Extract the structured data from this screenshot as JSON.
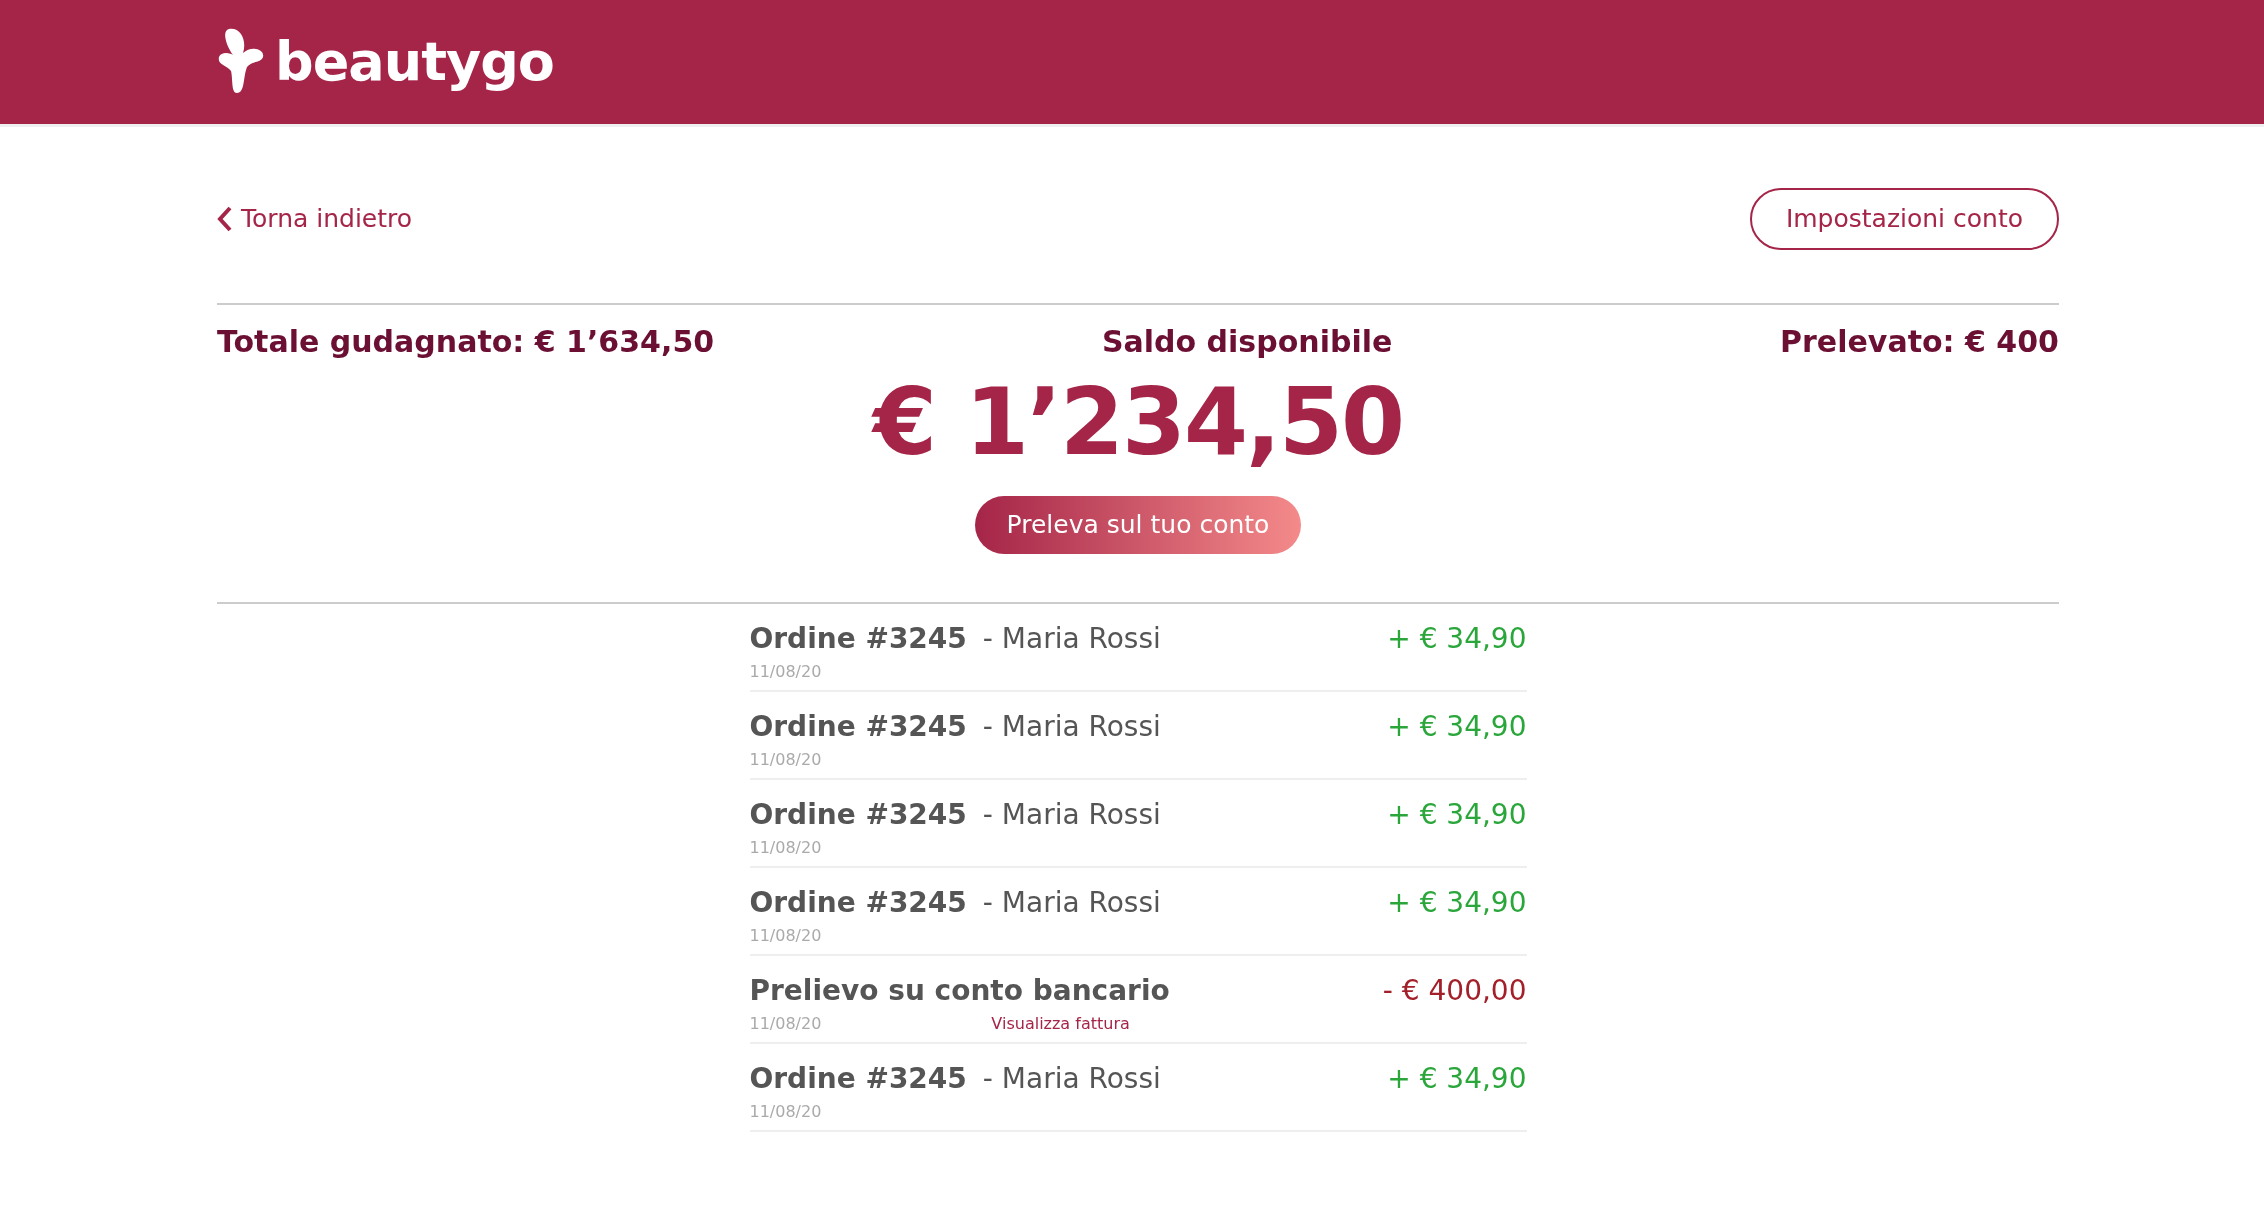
{
  "header": {
    "logo": "beautygo"
  },
  "back_link": "Torna indietro",
  "settings_button": "Impostazioni conto",
  "summary": {
    "earned": "Totale gudagnato: € 1’634,50",
    "balance_label": "Saldo disponibile",
    "withdrawn": "Prelevato: € 400"
  },
  "balance": "€ 1’234,50",
  "withdraw_button": "Preleva sul tuo conto",
  "transactions": [
    {
      "kind": "order",
      "title": "Ordine #3245",
      "customer": "- Maria Rossi",
      "date": "11/08/20",
      "amount": "+ € 34,90"
    },
    {
      "kind": "order",
      "title": "Ordine #3245",
      "customer": "- Maria Rossi",
      "date": "11/08/20",
      "amount": "+ € 34,90"
    },
    {
      "kind": "order",
      "title": "Ordine #3245",
      "customer": "- Maria Rossi",
      "date": "11/08/20",
      "amount": "+ € 34,90"
    },
    {
      "kind": "order",
      "title": "Ordine #3245",
      "customer": "- Maria Rossi",
      "date": "11/08/20",
      "amount": "+ € 34,90"
    },
    {
      "kind": "withdrawal",
      "title": "Prelievo su conto bancario",
      "date": "11/08/20",
      "link": "Visualizza fattura",
      "amount": "- € 400,00"
    },
    {
      "kind": "order",
      "title": "Ordine #3245",
      "customer": "- Maria Rossi",
      "date": "11/08/20",
      "amount": "+ € 34,90"
    }
  ]
}
